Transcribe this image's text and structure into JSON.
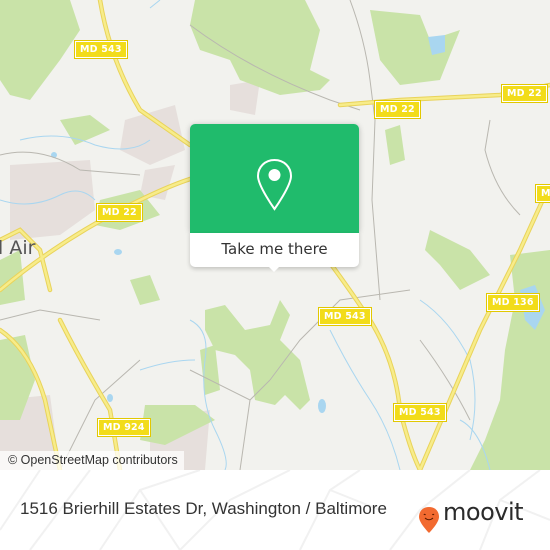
{
  "map": {
    "colors": {
      "land": "#f2f2ee",
      "wood": "#c9e3a8",
      "water": "#a9d6f0",
      "road_major": "#f5e56b",
      "road_minor": "#b9b7b0",
      "residential": "#e6dfdc",
      "shield_fill": "#f2dc1a",
      "popup_green": "#20bb6c",
      "brand_orange": "#f26a30"
    },
    "town_label": "l Air",
    "road_shields": [
      {
        "id": "md543-north",
        "label": "MD 543"
      },
      {
        "id": "md22-center",
        "label": "MD 22"
      },
      {
        "id": "md22-west",
        "label": "MD 22"
      },
      {
        "id": "md22-east",
        "label": "MD 22"
      },
      {
        "id": "md-partial-east",
        "label": "MD"
      },
      {
        "id": "md136",
        "label": "MD 136"
      },
      {
        "id": "md543-middle",
        "label": "MD 543"
      },
      {
        "id": "md543-south",
        "label": "MD 543"
      },
      {
        "id": "md924",
        "label": "MD 924"
      }
    ],
    "attribution": "© OpenStreetMap contributors"
  },
  "popup": {
    "icon": "location-pin-icon",
    "button_label": "Take me there"
  },
  "footer": {
    "address": "1516 Brierhill Estates Dr, Washington / Baltimore",
    "logo_icon": "moovit-pin-icon",
    "logo_text": "moovit"
  }
}
